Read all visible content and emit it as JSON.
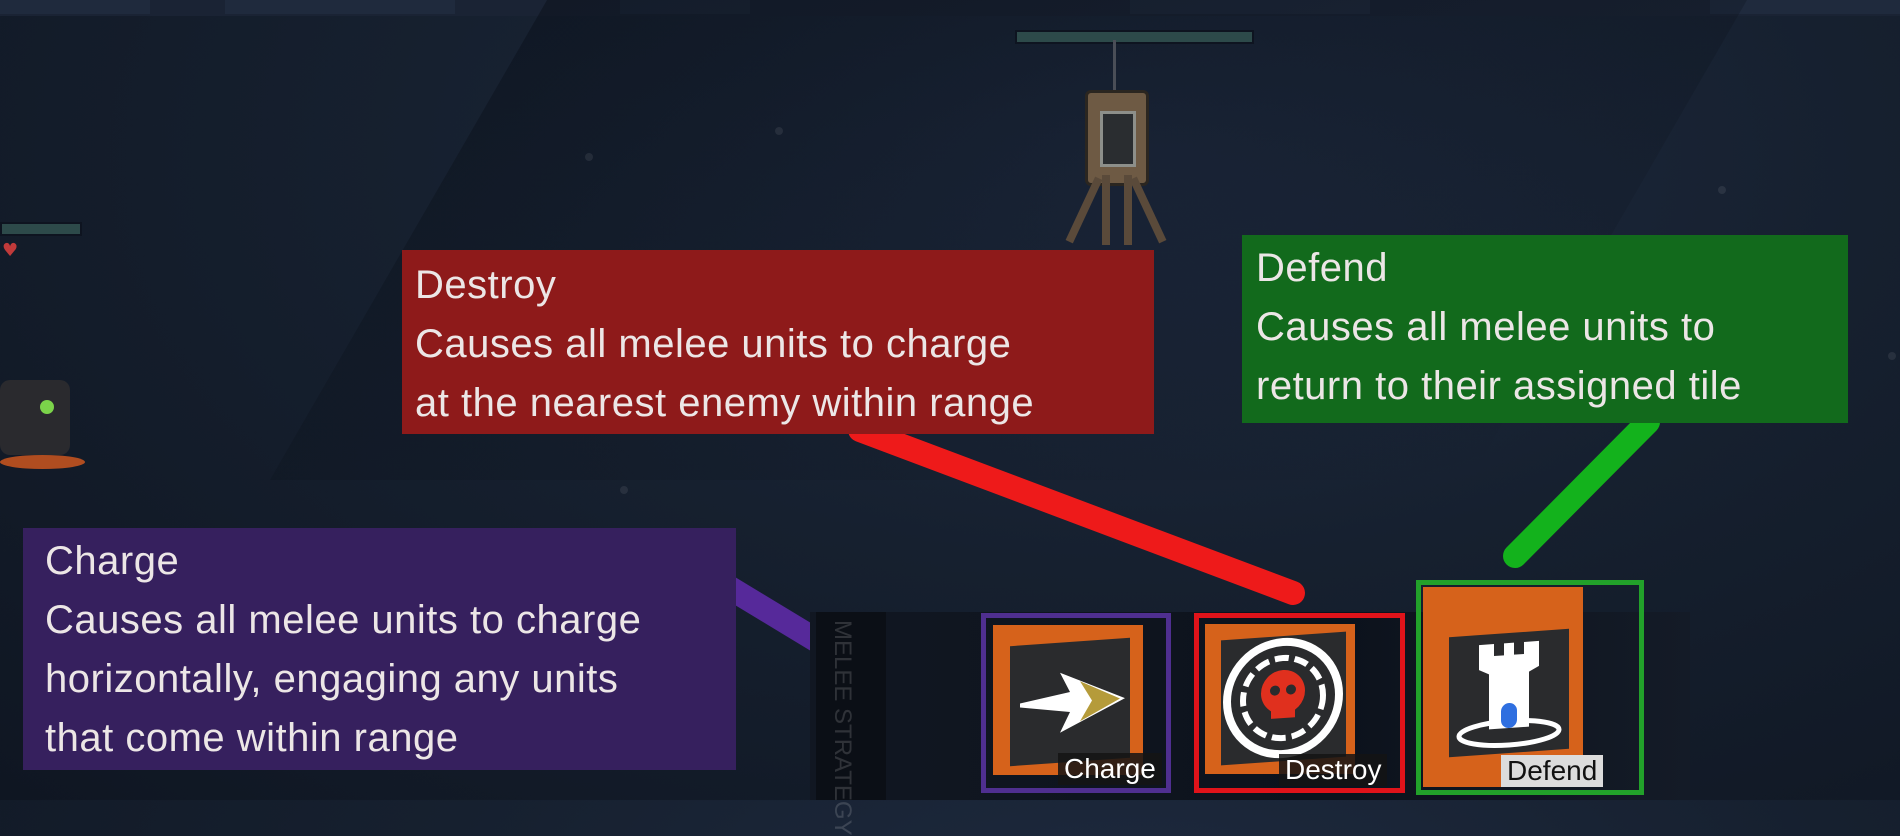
{
  "callouts": {
    "destroy": {
      "title": "Destroy",
      "line1": "Causes all melee units to charge",
      "line2": "at the nearest enemy within range"
    },
    "defend": {
      "title": "Defend",
      "line1": "Causes all melee units to",
      "line2": "return to their assigned tile"
    },
    "charge": {
      "title": "Charge",
      "line1": "Causes all melee units to charge",
      "line2": "horizontally, engaging any units",
      "line3": "that come within range"
    }
  },
  "action_bar": {
    "section_label": "MELEE STRATEGY",
    "buttons": [
      {
        "label": "Charge",
        "icon": "charge-arrow-icon",
        "outline_color": "#4f2f90"
      },
      {
        "label": "Destroy",
        "icon": "skull-target-icon",
        "outline_color": "#e0131a"
      },
      {
        "label": "Defend",
        "icon": "castle-tower-icon",
        "outline_color": "#22a12a"
      }
    ]
  },
  "colors": {
    "destroy_callout": "#8e1a1a",
    "defend_callout": "#126a1c",
    "charge_callout": "#36205e",
    "button_orange": "#d6621b"
  }
}
